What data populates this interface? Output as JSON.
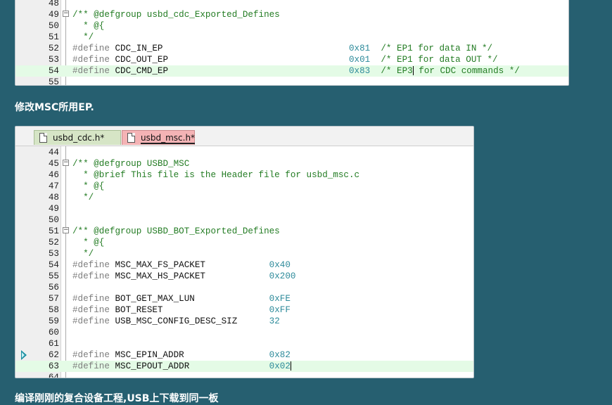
{
  "panel1": {
    "lines": [
      {
        "n": "48",
        "parts": []
      },
      {
        "n": "49",
        "fold": true,
        "parts": [
          {
            "t": "/** @defgroup usbd_cdc_Exported_Defines",
            "c": "cmt"
          }
        ]
      },
      {
        "n": "50",
        "parts": [
          {
            "t": "  * @{",
            "c": "cmt"
          }
        ]
      },
      {
        "n": "51",
        "parts": [
          {
            "t": "  */",
            "c": "cmt"
          }
        ]
      },
      {
        "n": "52",
        "parts": [
          {
            "t": "#define ",
            "c": "pre"
          },
          {
            "t": "CDC_IN_EP                                   ",
            "c": "id"
          },
          {
            "t": "0x81",
            "c": "num"
          },
          {
            "t": "  /* EP1 for data IN */",
            "c": "cmt"
          }
        ]
      },
      {
        "n": "53",
        "parts": [
          {
            "t": "#define ",
            "c": "pre"
          },
          {
            "t": "CDC_OUT_EP                                  ",
            "c": "id"
          },
          {
            "t": "0x01",
            "c": "num"
          },
          {
            "t": "  /* EP1 for data OUT */",
            "c": "cmt"
          }
        ]
      },
      {
        "n": "54",
        "current": true,
        "parts": [
          {
            "t": "#define ",
            "c": "pre"
          },
          {
            "t": "CDC_CMD_EP                                  ",
            "c": "id"
          },
          {
            "t": "0x83",
            "c": "num"
          },
          {
            "t": "  /* EP3",
            "c": "cmt"
          },
          {
            "cursor": true
          },
          {
            "t": " for CDC commands */",
            "c": "cmt"
          }
        ]
      },
      {
        "n": "55",
        "parts": []
      }
    ]
  },
  "caption1": "修改MSC所用EP.",
  "panel2": {
    "tabs": [
      {
        "label": "usbd_cdc.h*",
        "active": false
      },
      {
        "label": "usbd_msc.h*",
        "active": true
      }
    ],
    "lines": [
      {
        "n": "44",
        "parts": []
      },
      {
        "n": "45",
        "fold": true,
        "parts": [
          {
            "t": "/** @defgroup USBD_MSC",
            "c": "cmt"
          }
        ]
      },
      {
        "n": "46",
        "parts": [
          {
            "t": "  * @brief This file is the Header file for usbd_msc.c",
            "c": "cmt"
          }
        ]
      },
      {
        "n": "47",
        "parts": [
          {
            "t": "  * @{",
            "c": "cmt"
          }
        ]
      },
      {
        "n": "48",
        "parts": [
          {
            "t": "  */",
            "c": "cmt"
          }
        ]
      },
      {
        "n": "49",
        "parts": []
      },
      {
        "n": "50",
        "parts": []
      },
      {
        "n": "51",
        "fold": true,
        "parts": [
          {
            "t": "/** @defgroup USBD_BOT_Exported_Defines",
            "c": "cmt"
          }
        ]
      },
      {
        "n": "52",
        "parts": [
          {
            "t": "  * @{",
            "c": "cmt"
          }
        ]
      },
      {
        "n": "53",
        "parts": [
          {
            "t": "  */",
            "c": "cmt"
          }
        ]
      },
      {
        "n": "54",
        "parts": [
          {
            "t": "#define ",
            "c": "pre"
          },
          {
            "t": "MSC_MAX_FS_PACKET            ",
            "c": "id"
          },
          {
            "t": "0x40",
            "c": "num"
          }
        ]
      },
      {
        "n": "55",
        "parts": [
          {
            "t": "#define ",
            "c": "pre"
          },
          {
            "t": "MSC_MAX_HS_PACKET            ",
            "c": "id"
          },
          {
            "t": "0x200",
            "c": "num"
          }
        ]
      },
      {
        "n": "56",
        "parts": []
      },
      {
        "n": "57",
        "parts": [
          {
            "t": "#define ",
            "c": "pre"
          },
          {
            "t": "BOT_GET_MAX_LUN              ",
            "c": "id"
          },
          {
            "t": "0xFE",
            "c": "num"
          }
        ]
      },
      {
        "n": "58",
        "parts": [
          {
            "t": "#define ",
            "c": "pre"
          },
          {
            "t": "BOT_RESET                    ",
            "c": "id"
          },
          {
            "t": "0xFF",
            "c": "num"
          }
        ]
      },
      {
        "n": "59",
        "parts": [
          {
            "t": "#define ",
            "c": "pre"
          },
          {
            "t": "USB_MSC_CONFIG_DESC_SIZ      ",
            "c": "id"
          },
          {
            "t": "32",
            "c": "num"
          }
        ]
      },
      {
        "n": "60",
        "parts": []
      },
      {
        "n": "61",
        "parts": []
      },
      {
        "n": "62",
        "arrow": true,
        "parts": [
          {
            "t": "#define ",
            "c": "pre"
          },
          {
            "t": "MSC_EPIN_ADDR                ",
            "c": "id"
          },
          {
            "t": "0x82",
            "c": "num"
          }
        ]
      },
      {
        "n": "63",
        "current": true,
        "parts": [
          {
            "t": "#define ",
            "c": "pre"
          },
          {
            "t": "MSC_EPOUT_ADDR               ",
            "c": "id"
          },
          {
            "t": "0x02",
            "c": "num"
          },
          {
            "cursor": true
          }
        ]
      },
      {
        "n": "64",
        "parts": []
      }
    ]
  },
  "caption2": "编译刚刚的复合设备工程,USB上下载到同一板"
}
